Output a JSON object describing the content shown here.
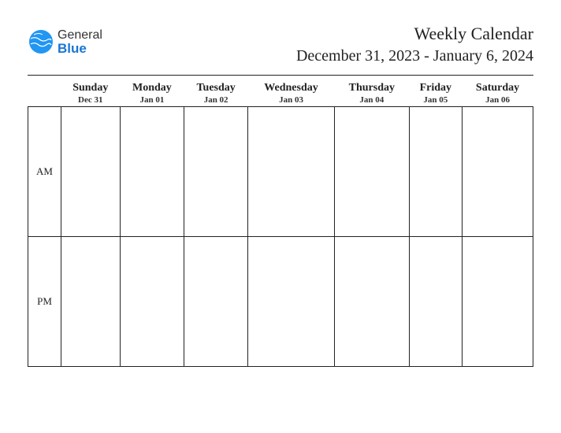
{
  "logo": {
    "text_top": "General",
    "text_bottom": "Blue"
  },
  "title": "Weekly Calendar",
  "date_range": "December 31, 2023 - January 6, 2024",
  "time_periods": [
    "AM",
    "PM"
  ],
  "days": [
    {
      "name": "Sunday",
      "date": "Dec 31"
    },
    {
      "name": "Monday",
      "date": "Jan 01"
    },
    {
      "name": "Tuesday",
      "date": "Jan 02"
    },
    {
      "name": "Wednesday",
      "date": "Jan 03"
    },
    {
      "name": "Thursday",
      "date": "Jan 04"
    },
    {
      "name": "Friday",
      "date": "Jan 05"
    },
    {
      "name": "Saturday",
      "date": "Jan 06"
    }
  ]
}
